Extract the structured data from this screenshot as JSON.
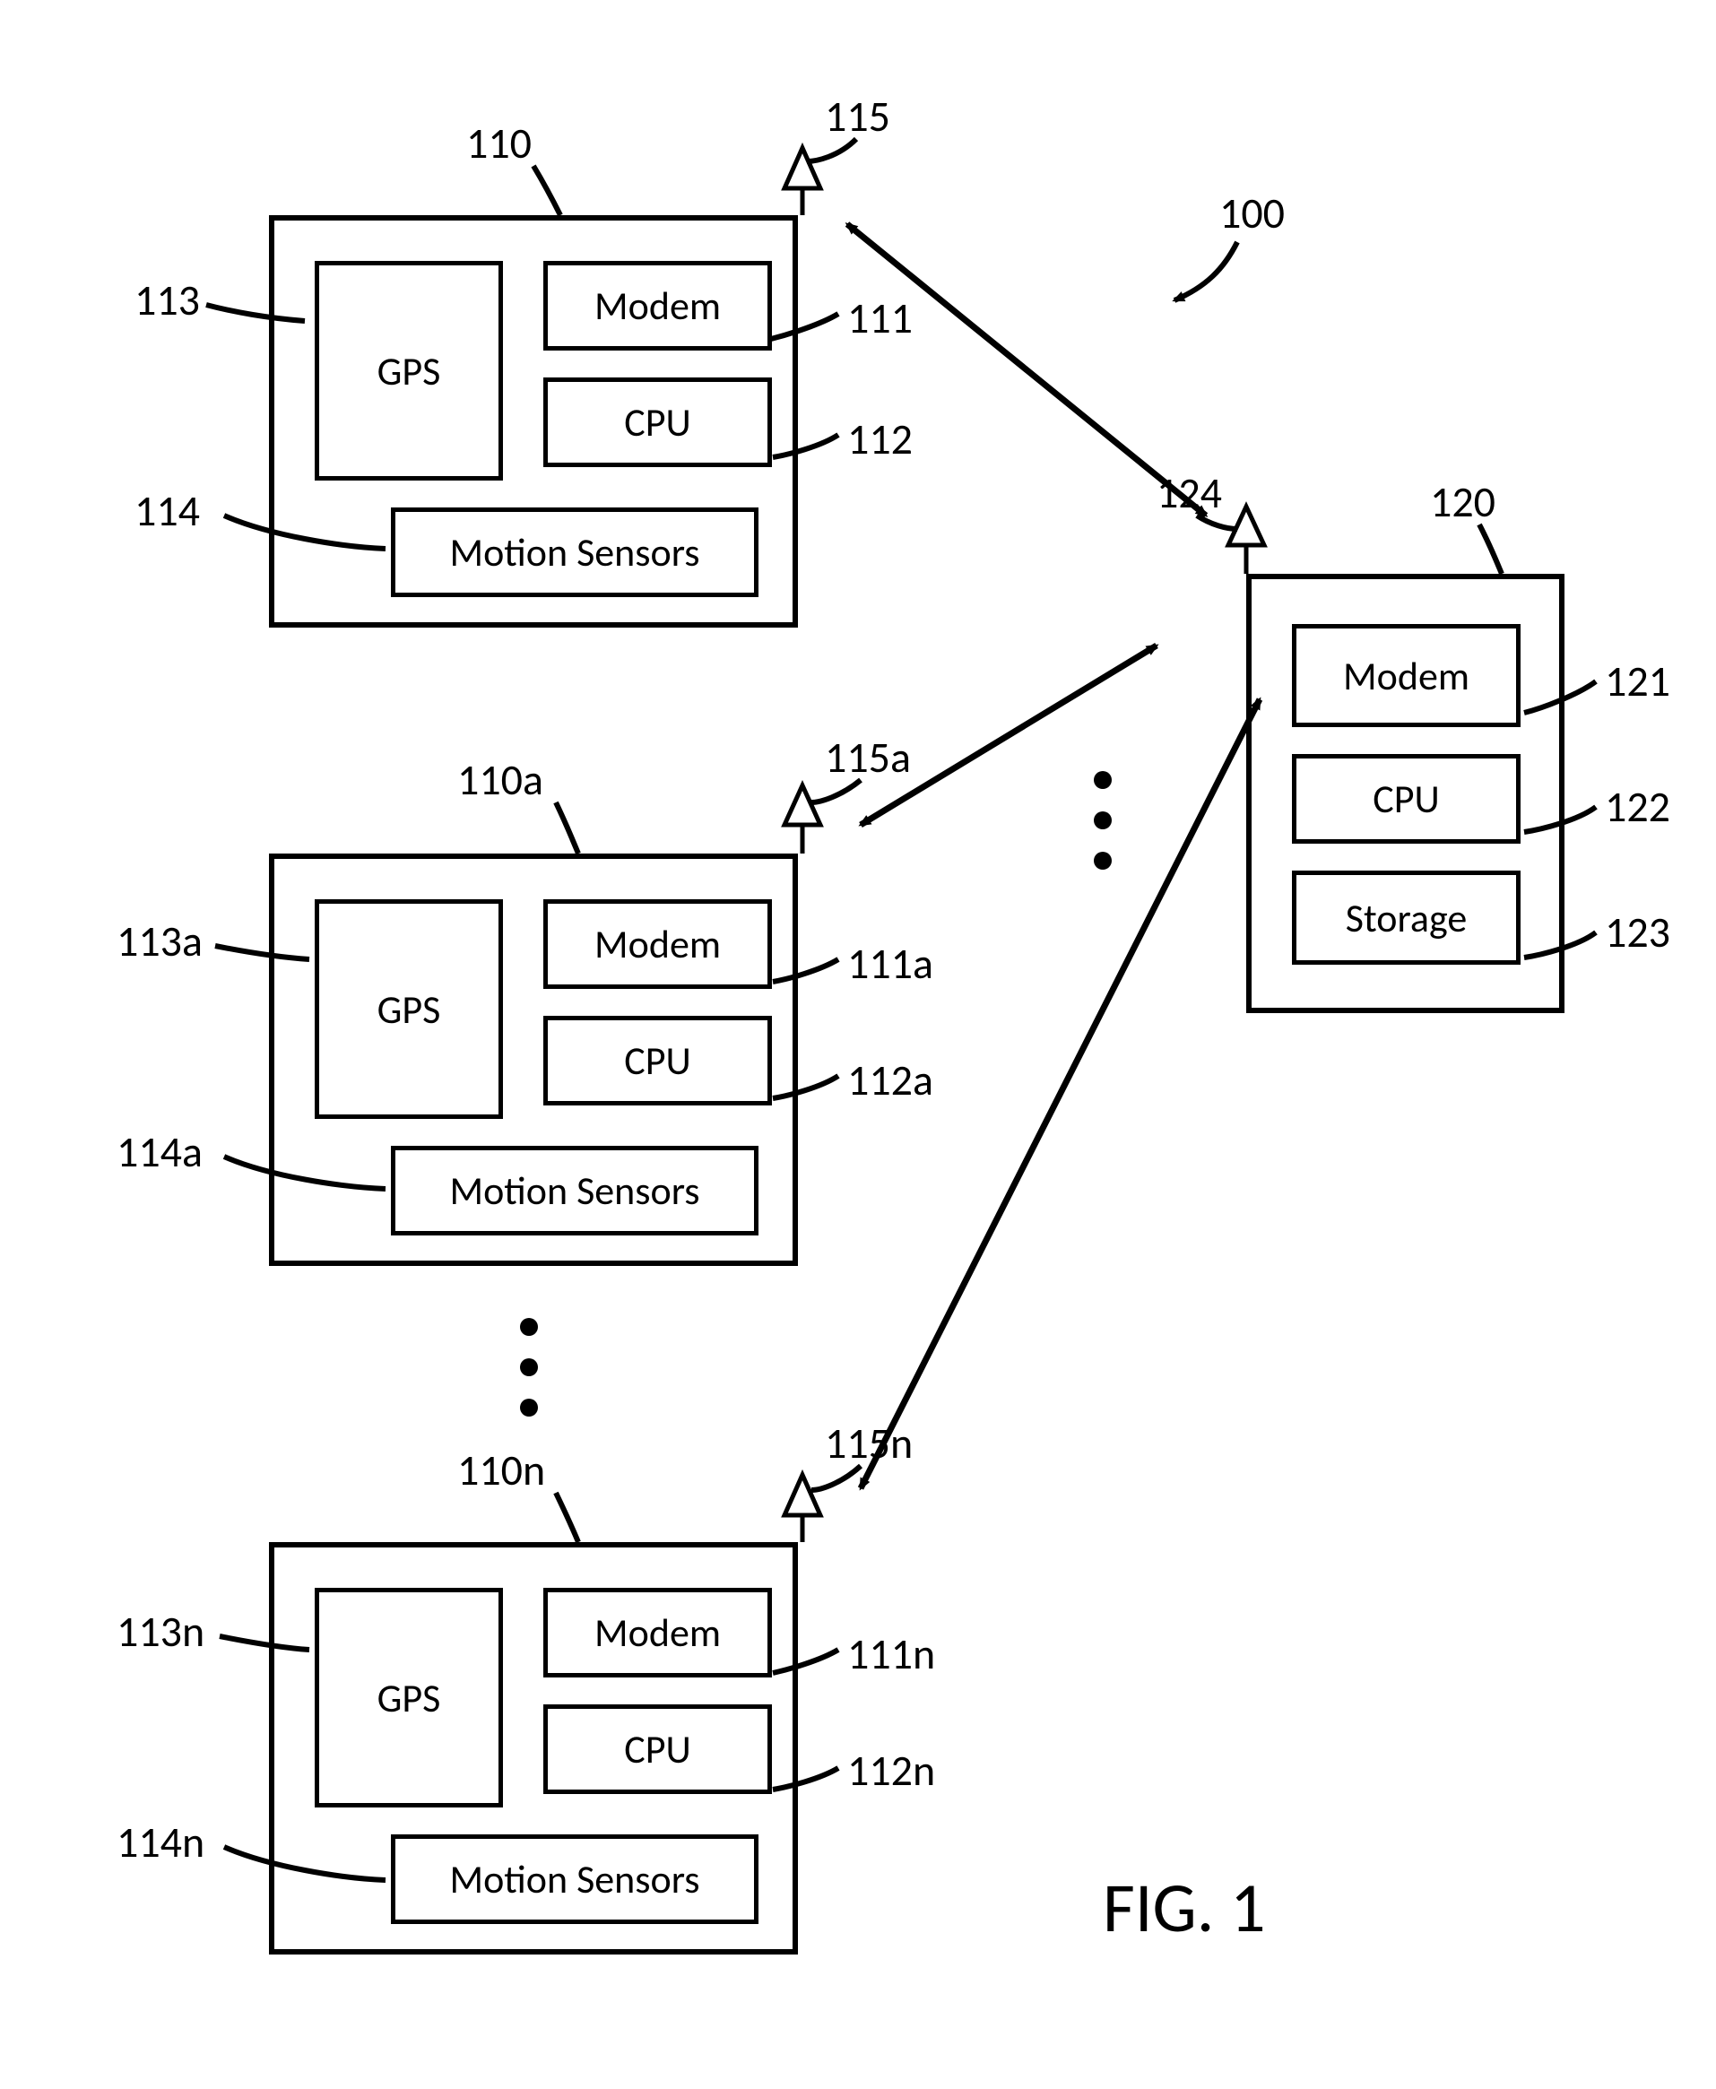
{
  "figure_caption": "FIG. 1",
  "labels": {
    "l100": "100",
    "l110": "110",
    "l110a": "110a",
    "l110n": "110n",
    "l111": "111",
    "l111a": "111a",
    "l111n": "111n",
    "l112": "112",
    "l112a": "112a",
    "l112n": "112n",
    "l113": "113",
    "l113a": "113a",
    "l113n": "113n",
    "l114": "114",
    "l114a": "114a",
    "l114n": "114n",
    "l115": "115",
    "l115a": "115a",
    "l115n": "115n",
    "l120": "120",
    "l121": "121",
    "l122": "122",
    "l123": "123",
    "l124": "124"
  },
  "clients": [
    {
      "gps": "GPS",
      "modem": "Modem",
      "cpu": "CPU",
      "motion": "Motion Sensors"
    },
    {
      "gps": "GPS",
      "modem": "Modem",
      "cpu": "CPU",
      "motion": "Motion Sensors"
    },
    {
      "gps": "GPS",
      "modem": "Modem",
      "cpu": "CPU",
      "motion": "Motion Sensors"
    }
  ],
  "server": {
    "modem": "Modem",
    "cpu": "CPU",
    "storage": "Storage"
  }
}
